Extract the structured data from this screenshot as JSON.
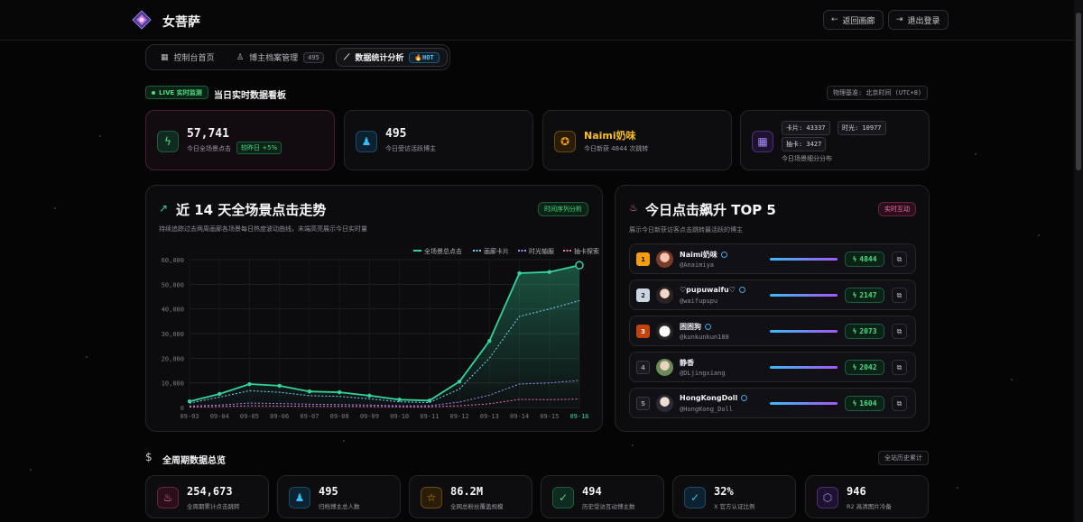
{
  "header": {
    "brand": "女菩萨",
    "back_label": "返回画廊",
    "logout_label": "退出登录"
  },
  "nav": {
    "tabs": [
      {
        "label": "控制台首页"
      },
      {
        "label": "博主档案管理",
        "badge": "495"
      },
      {
        "label": "数据统计分析",
        "badge": "HOT"
      }
    ]
  },
  "live": {
    "badge": "LIVE 实时监测",
    "title": "当日实时数据看板",
    "timezone": "物理基准: 北京时间 (UTC+8)"
  },
  "stats": [
    {
      "value": "57,741",
      "label": "今日全场景点击",
      "tag": "较昨日 +5%"
    },
    {
      "value": "495",
      "label": "今日受访活跃博主"
    },
    {
      "value": "Naimi奶味",
      "label": "今日新获 4844 次跳转"
    },
    {
      "chips": [
        "卡片: 43337",
        "时光: 10977",
        "抽卡: 3427"
      ],
      "label": "今日场景细分分布"
    }
  ],
  "trend": {
    "title": "近 14 天全场景点击走势",
    "tag": "时间序列分析",
    "desc": "持续追踪过去两周画廊各场景每日热度波动曲线，末端高亮展示今日实时量"
  },
  "chart_data": {
    "type": "line",
    "x": [
      "09-03",
      "09-04",
      "09-05",
      "09-06",
      "09-07",
      "09-08",
      "09-09",
      "09-10",
      "09-11",
      "09-12",
      "09-13",
      "09-14",
      "09-15",
      "09-16"
    ],
    "ylim": [
      0,
      60000
    ],
    "yticks": [
      "0",
      "10,000",
      "20,000",
      "30,000",
      "40,000",
      "50,000",
      "60,000"
    ],
    "series": [
      {
        "name": "全场景总点击",
        "color": "#34d399",
        "values": [
          2500,
          5500,
          9500,
          8800,
          6500,
          6200,
          4800,
          3200,
          2800,
          10500,
          27000,
          54500,
          55000,
          57741
        ]
      },
      {
        "name": "画廊卡片",
        "color": "#7dd3fc",
        "values": [
          1800,
          4200,
          6800,
          6200,
          4800,
          4500,
          3500,
          2300,
          2000,
          7500,
          20000,
          37000,
          40000,
          43337
        ]
      },
      {
        "name": "时光轴服",
        "color": "#a78bfa",
        "values": [
          600,
          1000,
          1800,
          1600,
          1300,
          1200,
          1000,
          700,
          700,
          2200,
          5000,
          9500,
          10000,
          10977
        ]
      },
      {
        "name": "抽卡探索",
        "color": "#f472b6",
        "values": [
          200,
          400,
          700,
          600,
          500,
          500,
          400,
          300,
          300,
          700,
          1500,
          3300,
          3200,
          3427
        ]
      }
    ]
  },
  "top5": {
    "title": "今日点击飙升 TOP 5",
    "tag": "实时互动",
    "desc": "展示今日新获访客点击跳转最活跃的博主",
    "rows": [
      {
        "rank": "1",
        "name": "Naimi奶味",
        "handle": "@Anaimiya",
        "count": "4844",
        "fill": 1.0
      },
      {
        "rank": "2",
        "name": "♡pupuwaifu♡",
        "handle": "@waifupupu",
        "count": "2147",
        "fill": 1.0
      },
      {
        "rank": "3",
        "name": "困困狗",
        "handle": "@kunkunkun188",
        "count": "2073",
        "fill": 1.0
      },
      {
        "rank": "4",
        "name": "静香",
        "handle": "@DLjingxiang",
        "count": "2042",
        "fill": 1.0
      },
      {
        "rank": "5",
        "name": "HongKongDoll",
        "handle": "@HongKong_Doll",
        "count": "1604",
        "fill": 1.0
      }
    ]
  },
  "overview": {
    "title": "全周期数据总览",
    "tag": "全站历史累计",
    "cards": [
      {
        "value": "254,673",
        "label": "全周期累计点击跳转"
      },
      {
        "value": "495",
        "label": "归档博主总人数"
      },
      {
        "value": "86.2M",
        "label": "全网总粉丝覆盖规模"
      },
      {
        "value": "494",
        "label": "历史受访互动博主数"
      },
      {
        "value": "32%",
        "label": "X 官方认证比例"
      },
      {
        "value": "946",
        "label": "R2 高清图片冷备"
      }
    ]
  },
  "colors": {
    "accent_green": "#34d399",
    "accent_pink": "#f472b6",
    "accent_blue": "#38bdf8",
    "accent_purple": "#a855f7"
  }
}
